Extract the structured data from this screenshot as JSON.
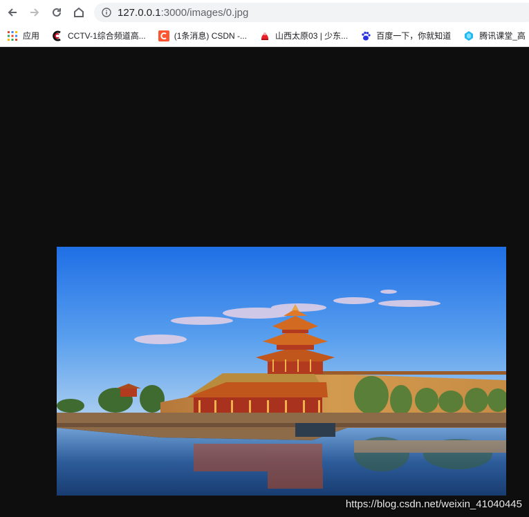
{
  "browser": {
    "url_host": "127.0.0.1",
    "url_path": ":3000/images/0.jpg"
  },
  "bookmarks": [
    {
      "label": "应用",
      "icon": "apps-grid-icon"
    },
    {
      "label": "CCTV-1综合频道高...",
      "icon": "cctv-logo-icon"
    },
    {
      "label": "(1条消息) CSDN -...",
      "icon": "csdn-logo-icon"
    },
    {
      "label": "山西太原03 | 少东...",
      "icon": "site-logo-icon"
    },
    {
      "label": "百度一下，你就知道",
      "icon": "baidu-paw-icon"
    },
    {
      "label": "腾讯课堂_高",
      "icon": "tencent-classroom-icon"
    }
  ],
  "viewer": {
    "image_subject": "Forbidden City corner tower at sunset reflected in moat",
    "watermark": "https://blog.csdn.net/weixin_41040445"
  },
  "colors": {
    "page_background": "#0e0e0e",
    "sky_top": "#1f6fe6",
    "sky_bottom": "#9fc4ee",
    "wall": "#c98a3e",
    "roof": "#c0561c",
    "water": "#1e4a86"
  }
}
